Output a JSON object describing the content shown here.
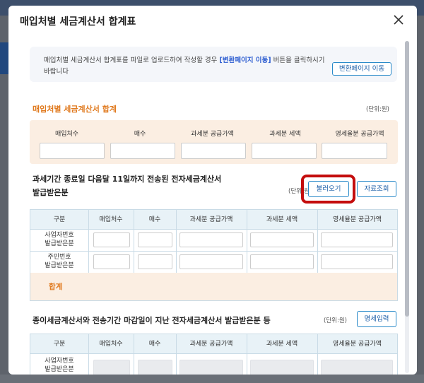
{
  "modal": {
    "title": "매입처별 세금계산서 합계표",
    "close_icon": "close-icon"
  },
  "notice": {
    "text_before": "매입처별 세금계산서 합계표를 파일로 업로드하여 작성할 경우",
    "link": "[변환페이지 이동]",
    "text_after": "버튼을 클릭하시기 바랍니다",
    "button": "변환페이지 이동"
  },
  "summary": {
    "title": "매입처별 세금계산서 합계",
    "unit": "(단위:원)",
    "columns": [
      "매입처수",
      "매수",
      "과세분 공급가액",
      "과세분 세액",
      "영세율분 공급가액"
    ]
  },
  "electronic": {
    "title_line1": "과세기간 종료일 다음달 11일까지 전송된 전자세금계산서",
    "title_line2": "발급받은분",
    "unit": "(단위:원)",
    "load_button": "불러오기",
    "query_button": "자료조회",
    "columns": [
      "구분",
      "매입처수",
      "매수",
      "과세분 공급가액",
      "과세분 세액",
      "영세율분 공급가액"
    ],
    "rows": [
      {
        "line1": "사업자번호",
        "line2": "발급받은분"
      },
      {
        "line1": "주민번호",
        "line2": "발급받은분"
      }
    ],
    "total_label": "합계"
  },
  "paper": {
    "title": "종이세금계산서와 전송기간 마감일이 지난 전자세금계산서 발급받은분 등",
    "unit": "(단위:원)",
    "detail_button": "명세입력",
    "columns": [
      "구분",
      "매입처수",
      "매수",
      "과세분 공급가액",
      "과세분 세액",
      "영세율분 공급가액"
    ],
    "rows": [
      {
        "line1": "사업자번호",
        "line2": "발급받은분"
      }
    ]
  },
  "colors": {
    "accent_orange": "#e07a1f",
    "accent_blue": "#1d5fa8",
    "highlight_red": "#c40d0d"
  }
}
